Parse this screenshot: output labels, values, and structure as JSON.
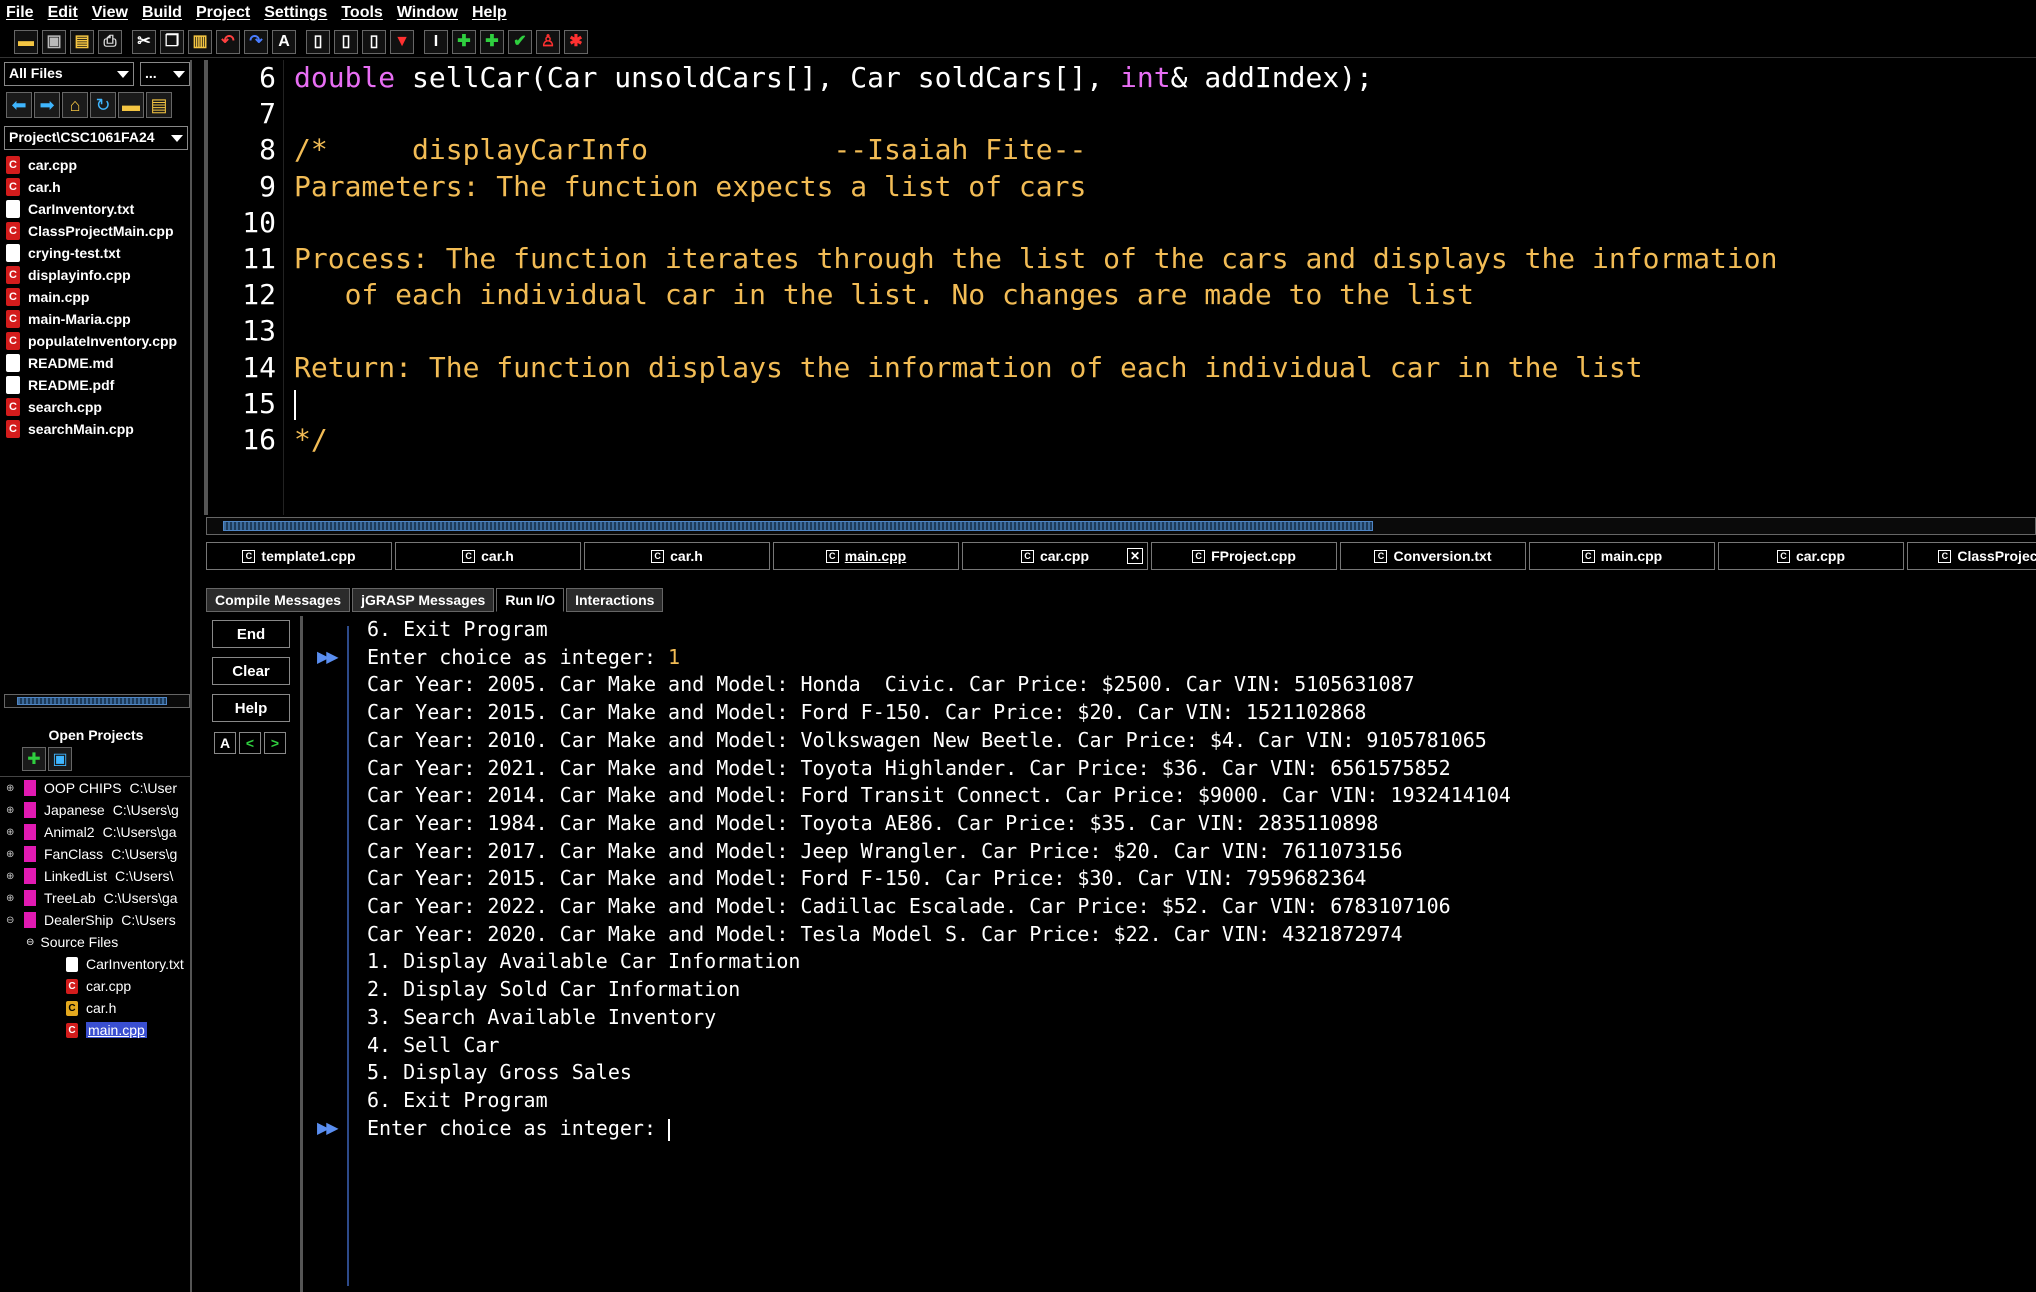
{
  "menu": [
    "File",
    "Edit",
    "View",
    "Build",
    "Project",
    "Settings",
    "Tools",
    "Window",
    "Help"
  ],
  "toolbar_icons": [
    "open-folder-icon",
    "save-icon",
    "save-all-icon",
    "print-icon",
    "cut-icon",
    "copy-icon",
    "paste-icon",
    "undo-icon",
    "redo-icon",
    "font-icon",
    "new-file-icon",
    "browse-icon",
    "edit-icon",
    "pin-icon",
    "text-cursor-icon",
    "generate-icon",
    "compile-icon",
    "check-icon",
    "run-icon",
    "debug-icon"
  ],
  "left_panel": {
    "filter": "All Files",
    "filter2": "...",
    "project_path": "Project\\CSC1061FA24",
    "files": [
      {
        "name": "car.cpp",
        "type": "c"
      },
      {
        "name": "car.h",
        "type": "c"
      },
      {
        "name": "CarInventory.txt",
        "type": "doc"
      },
      {
        "name": "ClassProjectMain.cpp",
        "type": "c"
      },
      {
        "name": "crying-test.txt",
        "type": "doc"
      },
      {
        "name": "displayinfo.cpp",
        "type": "c"
      },
      {
        "name": "main.cpp",
        "type": "c"
      },
      {
        "name": "main-Maria.cpp",
        "type": "c"
      },
      {
        "name": "populateInventory.cpp",
        "type": "c"
      },
      {
        "name": "README.md",
        "type": "doc"
      },
      {
        "name": "README.pdf",
        "type": "doc"
      },
      {
        "name": "search.cpp",
        "type": "c"
      },
      {
        "name": "searchMain.cpp",
        "type": "c"
      }
    ],
    "open_projects_title": "Open Projects",
    "projects": [
      {
        "name": "OOP CHIPS",
        "path": "C:\\User"
      },
      {
        "name": "Japanese",
        "path": "C:\\Users\\g"
      },
      {
        "name": "Animal2",
        "path": "C:\\Users\\ga"
      },
      {
        "name": "FanClass",
        "path": "C:\\Users\\g"
      },
      {
        "name": "LinkedList",
        "path": "C:\\Users\\"
      },
      {
        "name": "TreeLab",
        "path": "C:\\Users\\ga"
      },
      {
        "name": "DealerShip",
        "path": "C:\\Users"
      }
    ],
    "source_files_label": "Source Files",
    "source_files": [
      {
        "name": "CarInventory.txt",
        "type": "doc"
      },
      {
        "name": "car.cpp",
        "type": "c"
      },
      {
        "name": "car.h",
        "type": "h"
      },
      {
        "name": "main.cpp",
        "type": "c"
      }
    ]
  },
  "editor": {
    "lines": [
      {
        "num": "6",
        "parts": [
          {
            "t": "double",
            "c": "kw"
          },
          {
            "t": " sellCar(Car unsoldCars[], Car soldCars[], ",
            "c": "ty"
          },
          {
            "t": "int",
            "c": "kw"
          },
          {
            "t": "& addIndex);",
            "c": "ty"
          }
        ]
      },
      {
        "num": "7",
        "parts": []
      },
      {
        "num": "8",
        "parts": [
          {
            "t": "/*     displayCarInfo           --Isaiah Fite--",
            "c": "cm"
          }
        ]
      },
      {
        "num": "9",
        "parts": [
          {
            "t": "Parameters: The function expects a list of cars",
            "c": "cm"
          }
        ]
      },
      {
        "num": "10",
        "parts": []
      },
      {
        "num": "11",
        "parts": [
          {
            "t": "Process: The function iterates through the list of the cars and displays the information",
            "c": "cm"
          }
        ]
      },
      {
        "num": "12",
        "parts": [
          {
            "t": "   of each individual car in the list. No changes are made to the list",
            "c": "cm"
          }
        ]
      },
      {
        "num": "13",
        "parts": []
      },
      {
        "num": "14",
        "parts": [
          {
            "t": "Return: The function displays the information of each individual car in the list",
            "c": "cm"
          }
        ]
      },
      {
        "num": "15",
        "parts": []
      },
      {
        "num": "16",
        "parts": [
          {
            "t": "*/",
            "c": "cm"
          }
        ]
      }
    ]
  },
  "file_tabs": [
    {
      "label": "template1.cpp"
    },
    {
      "label": "car.h"
    },
    {
      "label": "car.h"
    },
    {
      "label": "main.cpp",
      "active": true
    },
    {
      "label": "car.cpp",
      "closable": true
    },
    {
      "label": "FProject.cpp"
    },
    {
      "label": "Conversion.txt"
    },
    {
      "label": "main.cpp"
    },
    {
      "label": "car.cpp"
    },
    {
      "label": "ClassProjectMa"
    }
  ],
  "bottom_tabs": [
    {
      "label": "Compile Messages"
    },
    {
      "label": "jGRASP Messages"
    },
    {
      "label": "Run I/O",
      "active": true
    },
    {
      "label": "Interactions"
    }
  ],
  "run_buttons": {
    "end": "End",
    "clear": "Clear",
    "help": "Help"
  },
  "console": {
    "lines": [
      {
        "text": "6. Exit Program"
      },
      {
        "text": "Enter choice as integer: ",
        "input": "1",
        "prompt": true
      },
      {
        "text": "Car Year: 2005. Car Make and Model: Honda  Civic. Car Price: $2500. Car VIN: 5105631087"
      },
      {
        "text": "Car Year: 2015. Car Make and Model: Ford F-150. Car Price: $20. Car VIN: 1521102868"
      },
      {
        "text": "Car Year: 2010. Car Make and Model: Volkswagen New Beetle. Car Price: $4. Car VIN: 9105781065"
      },
      {
        "text": "Car Year: 2021. Car Make and Model: Toyota Highlander. Car Price: $36. Car VIN: 6561575852"
      },
      {
        "text": "Car Year: 2014. Car Make and Model: Ford Transit Connect. Car Price: $9000. Car VIN: 1932414104"
      },
      {
        "text": "Car Year: 1984. Car Make and Model: Toyota AE86. Car Price: $35. Car VIN: 2835110898"
      },
      {
        "text": "Car Year: 2017. Car Make and Model: Jeep Wrangler. Car Price: $20. Car VIN: 7611073156"
      },
      {
        "text": "Car Year: 2015. Car Make and Model: Ford F-150. Car Price: $30. Car VIN: 7959682364"
      },
      {
        "text": "Car Year: 2022. Car Make and Model: Cadillac Escalade. Car Price: $52. Car VIN: 6783107106"
      },
      {
        "text": "Car Year: 2020. Car Make and Model: Tesla Model S. Car Price: $22. Car VIN: 4321872974"
      },
      {
        "text": "1. Display Available Car Information"
      },
      {
        "text": "2. Display Sold Car Information"
      },
      {
        "text": "3. Search Available Inventory"
      },
      {
        "text": "4. Sell Car"
      },
      {
        "text": "5. Display Gross Sales"
      },
      {
        "text": "6. Exit Program"
      },
      {
        "text": "Enter choice as integer: ",
        "prompt": true,
        "caret": true
      }
    ]
  }
}
